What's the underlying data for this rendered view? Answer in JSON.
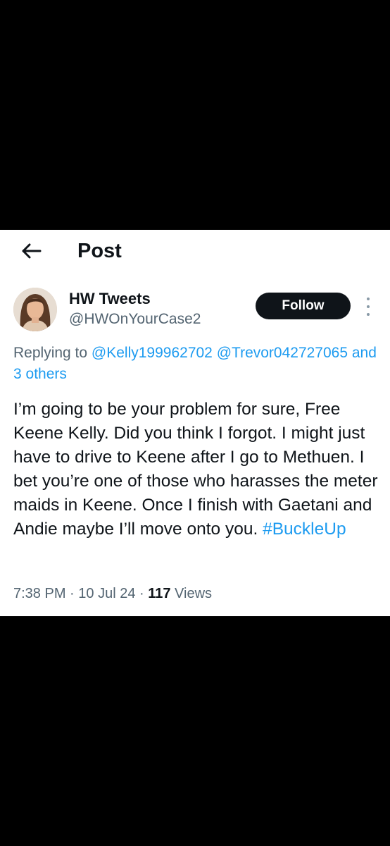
{
  "header": {
    "title": "Post"
  },
  "author": {
    "display_name": "HW Tweets",
    "handle": "@HWOnYourCase2"
  },
  "follow_label": "Follow",
  "reply": {
    "prefix": "Replying to",
    "mention_1": "@Kelly199962702",
    "mention_2": "@Trevor042727065",
    "others": "and 3 others"
  },
  "tweet": {
    "body": "I’m going to be your problem for sure, Free Keene Kelly. Did you think I forgot. I might just have to drive to Keene after I go to Methuen. I bet you’re one of those who harasses the meter maids in Keene. Once I finish with Gaetani and Andie maybe I’ll move onto you.",
    "hashtag": "#BuckleUp"
  },
  "meta": {
    "time": "7:38 PM",
    "date": "10 Jul 24",
    "views_count": "117",
    "views_label": "Views"
  },
  "colors": {
    "background": "#000000",
    "card": "#ffffff",
    "link": "#1d9bf0",
    "secondary_text": "#536471",
    "follow_button": "#0f1419"
  },
  "icons": {
    "back": "arrow-left-icon",
    "more": "more-vertical-icon"
  }
}
